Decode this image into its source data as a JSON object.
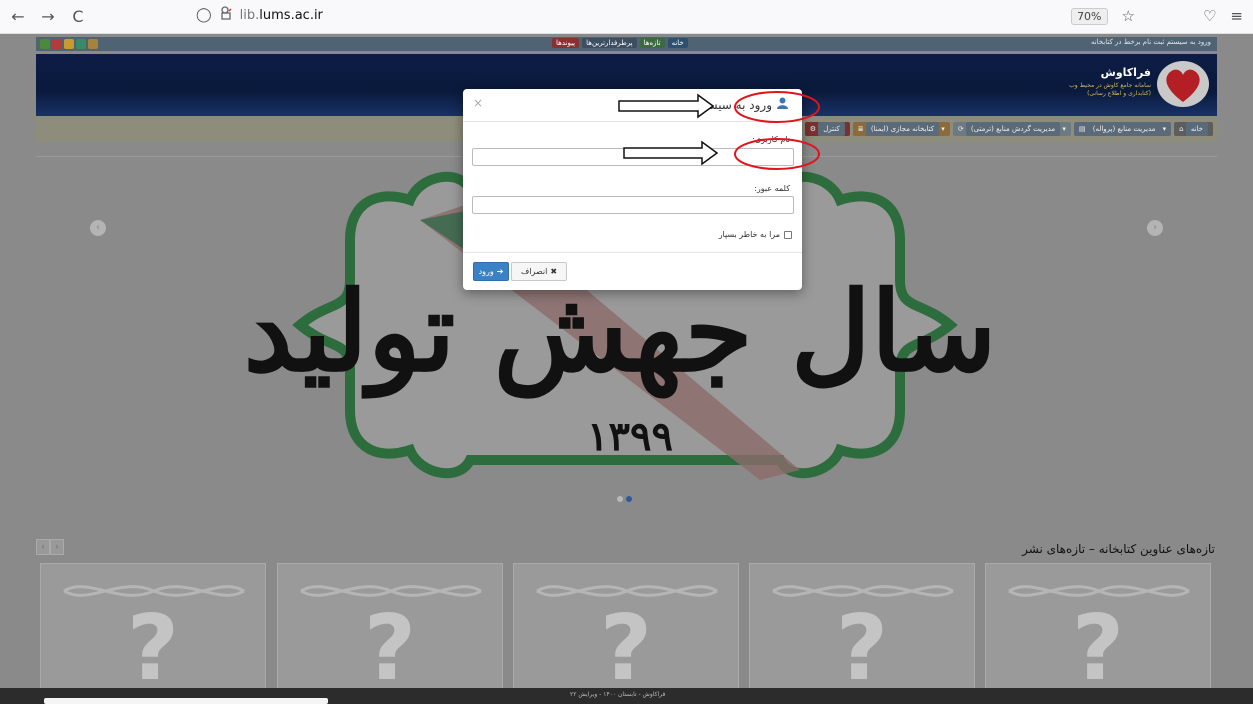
{
  "browser": {
    "back": "←",
    "forward": "→",
    "reload": "C",
    "url_host": "lib.",
    "url_domain": "lums.ac.ir",
    "zoom": "70%"
  },
  "topbar": {
    "links": [
      "پیوندها",
      "پرطرفدارترین‌ها",
      "تازه‌ها",
      "خانه"
    ],
    "auth": "ورود به سیستم  ثبت نام برخط در کتابخانه"
  },
  "banner": {
    "brand": "فراکاوش",
    "tagline_1": "سامانه جامع کاوش در محیط وب",
    "tagline_2": "(کتابداری و اطلاع رسانی)"
  },
  "menu": {
    "items": [
      "خانه",
      "مدیریت منابع (پرواله)",
      "مدیریت گردش منابع (ترمتی)",
      "کتابخانه مجازی (ایمنا)",
      "کنترل"
    ]
  },
  "slide": {
    "calligraphy": "سال جهش تولید",
    "year": "۱۳۹۹"
  },
  "section": {
    "title": "تازه‌های عناوین کتابخانه – تازه‌های نشر"
  },
  "books": [
    "?",
    "?",
    "?",
    "?",
    "?"
  ],
  "modal": {
    "title": "ورود به سیستم",
    "close": "×",
    "username_label": "نام کاربری:",
    "password_label": "کلمه عبور:",
    "remember_label": "مرا به خاطر بسپار",
    "login_button": "ورود",
    "cancel_button": "انصراف"
  },
  "footer": {
    "text": "فراکاوش - تابستان ۱۴۰۰ - ویرایش ۲۲"
  },
  "colors": {
    "accent": "#3b82c4",
    "annotation": "#e0141c",
    "overlay": "#8a8a8a"
  }
}
